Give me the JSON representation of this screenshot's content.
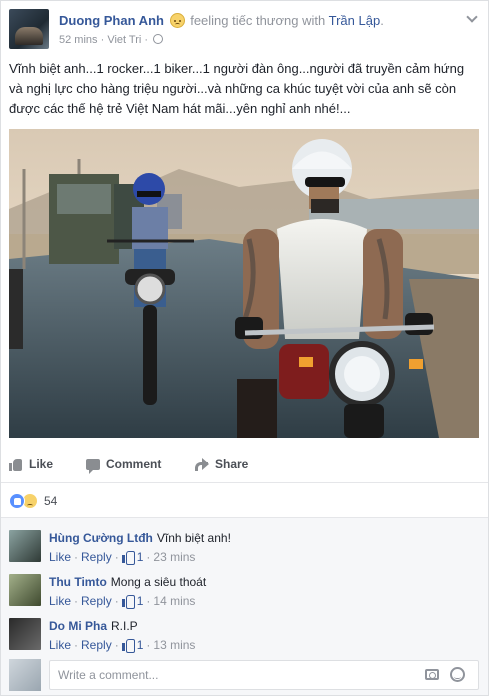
{
  "post": {
    "author": "Duong Phan Anh",
    "feeling": "feeling tiếc thương with",
    "tagged": "Trần Lập",
    "time": "52 mins",
    "location": "Viet Tri",
    "separator": " · ",
    "text": "Vĩnh biệt anh...1 rocker...1 biker...1 người đàn ông...người đã truyền cảm hứng và nghị lực cho hàng triệu người...và những ca khúc tuyệt vời của anh sẽ còn được các thế hệ trẻ Việt Nam hát mãi...yên nghỉ anh nhé!..."
  },
  "actions": {
    "like": "Like",
    "comment": "Comment",
    "share": "Share"
  },
  "reactions": {
    "count": "54"
  },
  "comments": [
    {
      "author": "Hùng Cường Ltđh",
      "text": "Vĩnh biệt anh!",
      "like": "Like",
      "reply": "Reply",
      "likes": "1",
      "time": "23 mins",
      "sep": "·"
    },
    {
      "author": "Thu Timto",
      "text": "Mong a siêu thoát",
      "like": "Like",
      "reply": "Reply",
      "likes": "1",
      "time": "14 mins",
      "sep": "·"
    },
    {
      "author": "Do Mi Pha",
      "text": "R.I.P",
      "like": "Like",
      "reply": "Reply",
      "likes": "1",
      "time": "13 mins",
      "sep": "·"
    }
  ],
  "composer": {
    "placeholder": "Write a comment..."
  },
  "colors": {
    "link": "#365899",
    "meta": "#90949c",
    "comments_bg": "#f6f7f9"
  }
}
